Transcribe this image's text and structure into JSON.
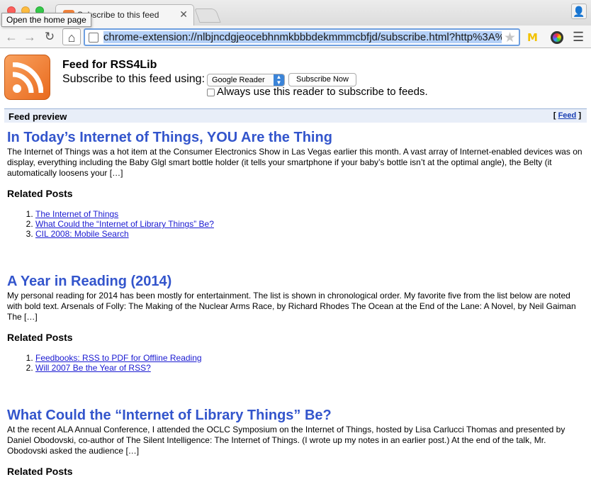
{
  "browser": {
    "tab_title": "Subscribe to this feed",
    "tooltip": "Open the home page",
    "url": "chrome-extension://nlbjncdgjeocebhnmkbbbdekmmmcbfjd/subscribe.html?http%3A%2"
  },
  "subscribe": {
    "feed_title": "Feed for RSS4Lib",
    "label": "Subscribe to this feed using:",
    "selected_reader": "Google Reader",
    "button": "Subscribe Now",
    "always_label": "Always use this reader to subscribe to feeds."
  },
  "preview": {
    "label": "Feed preview",
    "bracket_open": "[",
    "feed_link": "Feed",
    "bracket_close": "]"
  },
  "posts": [
    {
      "title": "In Today’s Internet of Things, YOU Are the Thing",
      "excerpt": "The Internet of Things was a hot item at the Consumer Electronics Show in Las Vegas earlier this month. A vast array of Internet-enabled devices was on display, everything including the Baby Glgl smart bottle holder (it tells your smartphone if your baby’s bottle isn’t at the optimal angle), the Belty (it automatically loosens your […]",
      "related_heading": "Related Posts",
      "related": [
        "The Internet of Things",
        "What Could the “Internet of Library Things” Be?",
        "CIL 2008: Mobile Search"
      ]
    },
    {
      "title": "A Year in Reading (2014)",
      "excerpt": "My personal reading for 2014 has been mostly for entertainment. The list is shown in chronological order. My favorite five from the list below are noted with bold text. Arsenals of Folly: The Making of the Nuclear Arms Race, by Richard Rhodes The Ocean at the End of the Lane: A Novel, by Neil Gaiman The […]",
      "related_heading": "Related Posts",
      "related": [
        "Feedbooks: RSS to PDF for Offline Reading",
        "Will 2007 Be the Year of RSS?"
      ]
    },
    {
      "title": "What Could the “Internet of Library Things” Be?",
      "excerpt": "At the recent ALA Annual Conference, I attended the OCLC Symposium on the Internet of Things, hosted by Lisa Carlucci Thomas and presented by Daniel Obodovski, co-author of The Silent Intelligence: The Internet of Things. (I wrote up my notes in an earlier post.) At the end of the talk, Mr. Obodovski asked the audience […]",
      "related_heading": "Related Posts"
    }
  ]
}
